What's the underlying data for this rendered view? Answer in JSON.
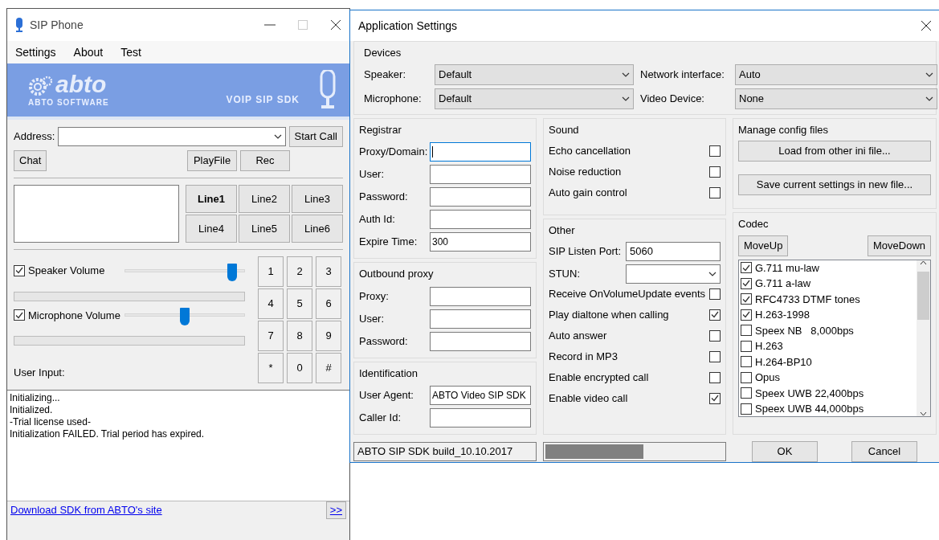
{
  "phone": {
    "title": "SIP Phone",
    "menu": [
      "Settings",
      "About",
      "Test"
    ],
    "banner": {
      "brand": "abto",
      "company": "ABTO SOFTWARE",
      "tagline": "VOIP SIP SDK"
    },
    "address_label": "Address:",
    "start_call": "Start Call",
    "buttons_left": [
      "Chat"
    ],
    "buttons_right": [
      "PlayFile",
      "Rec"
    ],
    "lines": [
      {
        "label": "Line1",
        "selected": true
      },
      {
        "label": "Line2",
        "selected": false
      },
      {
        "label": "Line3",
        "selected": false
      },
      {
        "label": "Line4",
        "selected": false
      },
      {
        "label": "Line5",
        "selected": false
      },
      {
        "label": "Line6",
        "selected": false
      }
    ],
    "volumes": [
      {
        "label": "Speaker Volume",
        "checked": true,
        "level": 0.9
      },
      {
        "label": "Microphone Volume",
        "checked": true,
        "level": 0.5
      }
    ],
    "user_input_label": "User Input:",
    "keypad": [
      "1",
      "2",
      "3",
      "4",
      "5",
      "6",
      "7",
      "8",
      "9",
      "*",
      "0",
      "#"
    ],
    "log": [
      "Initializing...",
      "Initialized.",
      "-Trial license used-",
      "Initialization FAILED. Trial period has expired."
    ],
    "download_link": "Download SDK from ABTO's site",
    "more_button": ">>"
  },
  "settings": {
    "title": "Application Settings",
    "devices": {
      "title": "Devices",
      "fields": [
        {
          "label": "Speaker:",
          "value": "Default"
        },
        {
          "label": "Microphone:",
          "value": "Default"
        },
        {
          "label": "Network interface:",
          "value": "Auto"
        },
        {
          "label": "Video Device:",
          "value": "None"
        }
      ]
    },
    "registrar": {
      "title": "Registrar",
      "fields": [
        {
          "label": "Proxy/Domain:",
          "focused": true
        },
        {
          "label": "User:"
        },
        {
          "label": "Password:"
        },
        {
          "label": "Auth Id:"
        },
        {
          "label": "Expire Time:",
          "value": "300"
        }
      ]
    },
    "outbound_proxy": {
      "title": "Outbound proxy",
      "fields": [
        {
          "label": "Proxy:"
        },
        {
          "label": "User:"
        },
        {
          "label": "Password:"
        }
      ]
    },
    "identification": {
      "title": "Identification",
      "fields": [
        {
          "label": "User Agent:",
          "value": "ABTO Video SIP SDK"
        },
        {
          "label": "Caller Id:"
        }
      ]
    },
    "sound": {
      "title": "Sound",
      "options": [
        {
          "label": "Echo cancellation",
          "checked": false
        },
        {
          "label": "Noise reduction",
          "checked": false
        },
        {
          "label": "Auto gain control",
          "checked": false
        }
      ]
    },
    "other": {
      "title": "Other",
      "port_label": "SIP Listen Port:",
      "port_value": "5060",
      "stun_label": "STUN:",
      "options": [
        {
          "label": "Receive OnVolumeUpdate events",
          "checked": false
        },
        {
          "label": "Play dialtone when calling",
          "checked": true
        },
        {
          "label": "Auto answer",
          "checked": false
        },
        {
          "label": "Record in MP3",
          "checked": false
        },
        {
          "label": "Enable encrypted call",
          "checked": false
        },
        {
          "label": "Enable video call",
          "checked": true
        }
      ]
    },
    "config": {
      "title": "Manage config files",
      "buttons": [
        "Load from other ini file...",
        "Save current settings in new file..."
      ]
    },
    "codec": {
      "title": "Codec",
      "move_up": "MoveUp",
      "move_down": "MoveDown",
      "items": [
        {
          "label": "G.711 mu-law",
          "checked": true
        },
        {
          "label": "G.711 a-law",
          "checked": true
        },
        {
          "label": "RFC4733 DTMF tones",
          "checked": true
        },
        {
          "label": "H.263-1998",
          "checked": true
        },
        {
          "label": "Speex NB   8,000bps",
          "checked": false
        },
        {
          "label": "H.263",
          "checked": false
        },
        {
          "label": "H.264-BP10",
          "checked": false
        },
        {
          "label": "Opus",
          "checked": false
        },
        {
          "label": "Speex UWB 22,400bps",
          "checked": false
        },
        {
          "label": "Speex UWB 44,000bps",
          "checked": false
        }
      ]
    },
    "build": "ABTO SIP SDK build_10.10.2017",
    "progress": {
      "level": 0.55
    },
    "ok": "OK",
    "cancel": "Cancel"
  }
}
